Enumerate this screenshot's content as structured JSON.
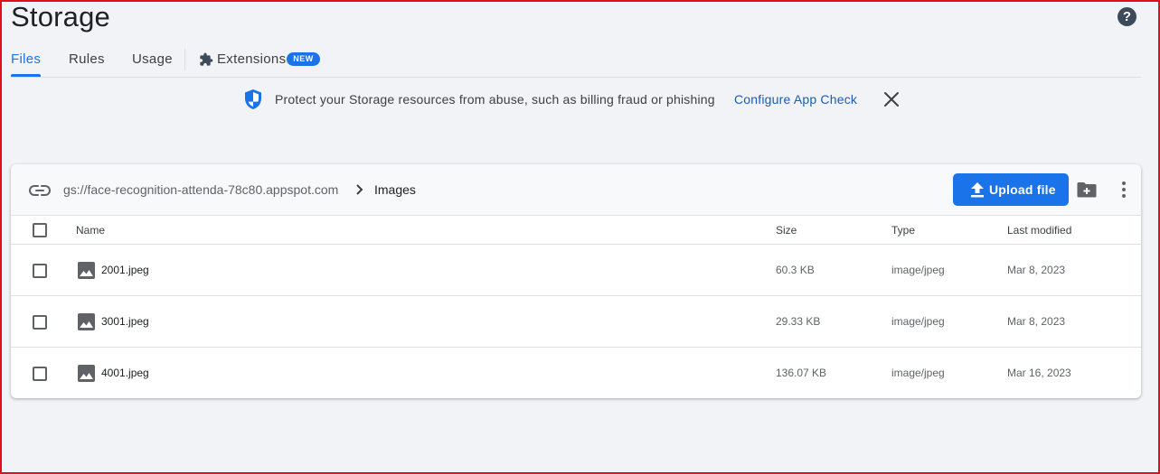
{
  "header": {
    "title": "Storage",
    "help_icon": "help-icon"
  },
  "tabs": [
    {
      "label": "Files",
      "active": true
    },
    {
      "label": "Rules",
      "active": false
    },
    {
      "label": "Usage",
      "active": false
    },
    {
      "label": "Extensions",
      "badge": "NEW",
      "icon": "extension-icon"
    }
  ],
  "banner": {
    "icon": "shield-icon",
    "text": "Protect your Storage resources from abuse, such as billing fraud or phishing",
    "link": "Configure App Check",
    "close_icon": "close-icon"
  },
  "browser": {
    "bucket": "gs://face-recognition-attenda-78c80.appspot.com",
    "folder": "Images",
    "upload_label": "Upload file",
    "columns": {
      "name": "Name",
      "size": "Size",
      "type": "Type",
      "modified": "Last modified"
    },
    "files": [
      {
        "name": "2001.jpeg",
        "size": "60.3 KB",
        "type": "image/jpeg",
        "modified": "Mar 8, 2023"
      },
      {
        "name": "3001.jpeg",
        "size": "29.33 KB",
        "type": "image/jpeg",
        "modified": "Mar 8, 2023"
      },
      {
        "name": "4001.jpeg",
        "size": "136.07 KB",
        "type": "image/jpeg",
        "modified": "Mar 16, 2023"
      }
    ]
  },
  "colors": {
    "accent": "#1a73e8",
    "background": "#f1f3f6",
    "frame": "#e0101a"
  }
}
